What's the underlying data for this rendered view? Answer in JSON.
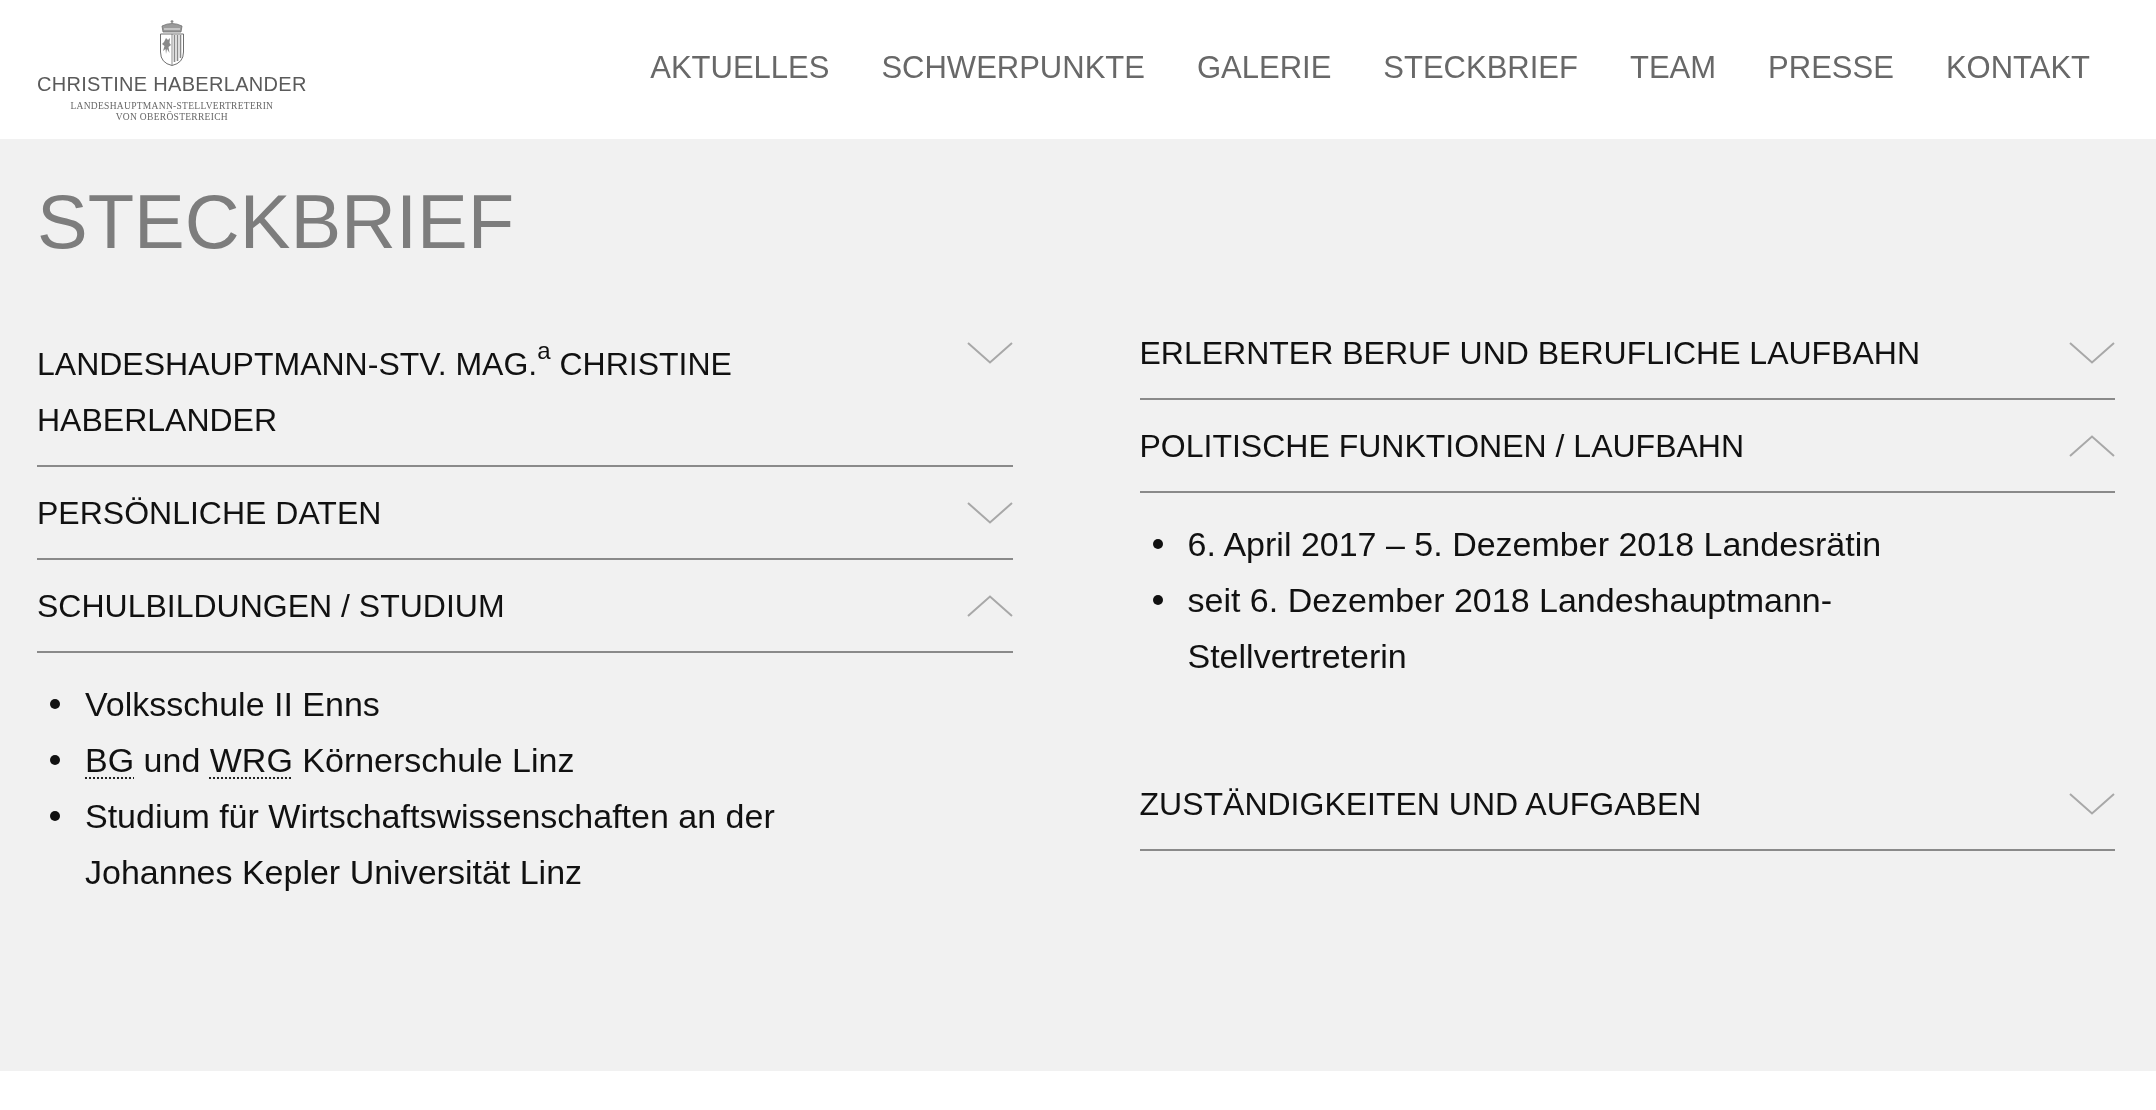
{
  "header": {
    "logo": {
      "name": "CHRISTINE HABERLANDER",
      "subtitle_lines": [
        "LANDESHAUPTMANN-STELLVERTRETERIN",
        "VON OBERÖSTERREICH"
      ]
    },
    "nav": [
      "AKTUELLES",
      "SCHWERPUNKTE",
      "GALERIE",
      "STECKBRIEF",
      "TEAM",
      "PRESSE",
      "KONTAKT"
    ]
  },
  "page_title": "STECKBRIEF",
  "columns": [
    {
      "sections": [
        {
          "title": "LANDESHAUPTMANN-STV. MAG.$^{a}$ CHRISTINE HABERLANDER",
          "expanded": false
        },
        {
          "title": "PERSÖNLICHE DATEN",
          "expanded": false
        },
        {
          "title": "SCHULBILDUNGEN / STUDIUM",
          "expanded": true,
          "items": [
            {
              "parts": [
                {
                  "text": "Volksschule II Enns",
                  "abbr": false
                }
              ]
            },
            {
              "parts": [
                {
                  "text": "BG",
                  "abbr": true
                },
                {
                  "text": " und ",
                  "abbr": false
                },
                {
                  "text": "WRG",
                  "abbr": true
                },
                {
                  "text": " Körnerschule Linz",
                  "abbr": false
                }
              ]
            },
            {
              "parts": [
                {
                  "text": "Studium für Wirtschaftswissenschaften an der Johannes Kepler Universität Linz",
                  "abbr": false
                }
              ]
            }
          ]
        }
      ]
    },
    {
      "sections": [
        {
          "title": "ERLERNTER BERUF UND BERUFLICHE LAUFBAHN",
          "expanded": false
        },
        {
          "title": "POLITISCHE FUNKTIONEN / LAUFBAHN",
          "expanded": true,
          "items": [
            {
              "parts": [
                {
                  "text": "6. April 2017 – 5. Dezember 2018 Landesrätin",
                  "abbr": false
                }
              ]
            },
            {
              "parts": [
                {
                  "text": "seit 6. Dezember 2018 Landeshauptmann-Stellvertreterin",
                  "abbr": false
                }
              ]
            }
          ]
        },
        {
          "title": "ZUSTÄNDIGKEITEN UND AUFGABEN",
          "expanded": false
        }
      ]
    }
  ]
}
